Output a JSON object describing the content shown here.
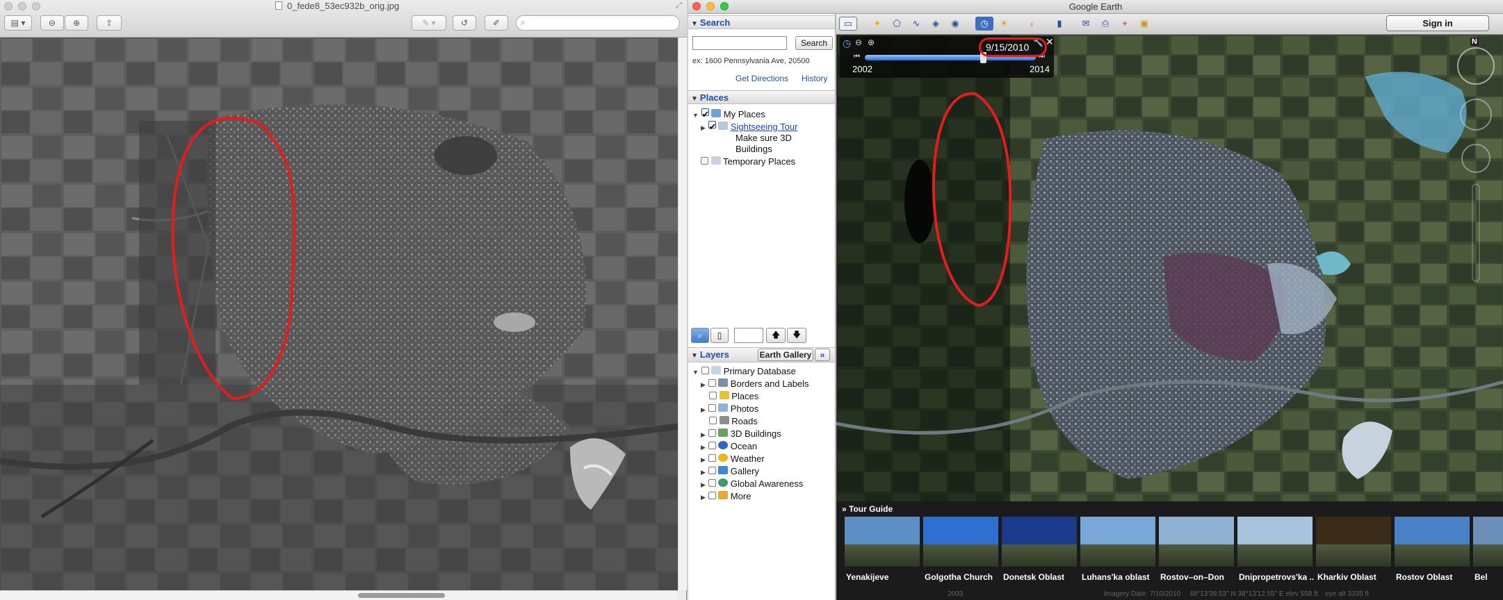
{
  "preview": {
    "title": "0_fede8_53ec932b_orig.jpg",
    "search_placeholder": ""
  },
  "earth": {
    "window_title": "Google Earth",
    "search": {
      "header": "Search",
      "button": "Search",
      "hint": "ex: 1600 Pennsylvania Ave, 20500",
      "get_directions": "Get Directions",
      "history": "History",
      "value": ""
    },
    "places": {
      "header": "Places",
      "my_places": "My Places",
      "sightseeing_tour": "Sightseeing Tour",
      "tour_note_line1": "Make sure 3D",
      "tour_note_line2": "Buildings",
      "temporary_places": "Temporary Places"
    },
    "layers": {
      "header": "Layers",
      "gallery_button": "Earth Gallery",
      "gallery_more": "»",
      "items": [
        {
          "label": "Primary Database"
        },
        {
          "label": "Borders and Labels"
        },
        {
          "label": "Places"
        },
        {
          "label": "Photos"
        },
        {
          "label": "Roads"
        },
        {
          "label": "3D Buildings"
        },
        {
          "label": "Ocean"
        },
        {
          "label": "Weather"
        },
        {
          "label": "Gallery"
        },
        {
          "label": "Global Awareness"
        },
        {
          "label": "More"
        }
      ]
    },
    "toolbar": {
      "sign_in": "Sign in"
    },
    "time_slider": {
      "date": "9/15/2010",
      "start_year": "2002",
      "end_year": "2014",
      "position": 0.69
    },
    "compass": {
      "north": "N"
    },
    "tour_guide": {
      "header": "Tour Guide",
      "items": [
        {
          "label": "Yenakijeve",
          "color": "#5d8fc4"
        },
        {
          "label": "Golgotha Church",
          "color": "#2f6fd0"
        },
        {
          "label": "Donetsk Oblast",
          "color": "#1b3a8c"
        },
        {
          "label": "Luhans'ka oblast",
          "color": "#79a8d8"
        },
        {
          "label": "Rostov–on–Don",
          "color": "#8fb2d3"
        },
        {
          "label": "Dnipropetrovs'ka ...",
          "color": "#a8c4dd"
        },
        {
          "label": "Kharkiv Oblast",
          "color": "#3a2a18"
        },
        {
          "label": "Rostov Oblast",
          "color": "#4a82c8"
        },
        {
          "label": "Bel",
          "color": "#6b8fb9"
        }
      ]
    },
    "status": {
      "year": "2003",
      "imagery_date": "Imagery Date: 7/10/2010",
      "coords": "48°13'39.53\" N   38°13'12.55\" E   elev   558 ft",
      "eye_alt": "eye alt  3335 ft"
    }
  },
  "colors": {
    "annotation_red": "#e21d1d",
    "link_blue": "#1a3ebf"
  }
}
